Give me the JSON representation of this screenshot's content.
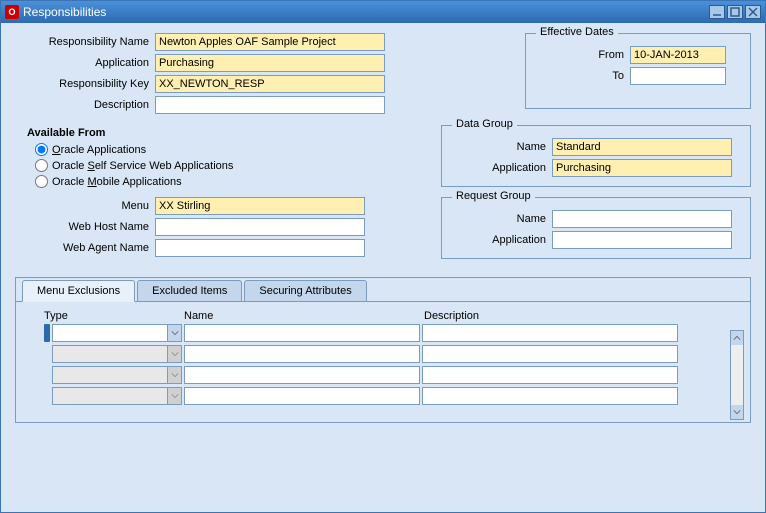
{
  "window": {
    "title": "Responsibilities"
  },
  "fields": {
    "resp_name_label": "Responsibility Name",
    "resp_name": "Newton Apples OAF Sample Project",
    "application_label": "Application",
    "application": "Purchasing",
    "resp_key_label": "Responsibility Key",
    "resp_key": "XX_NEWTON_RESP",
    "description_label": "Description",
    "description": ""
  },
  "effective": {
    "legend": "Effective Dates",
    "from_label": "From",
    "from": "10-JAN-2013",
    "to_label": "To",
    "to": ""
  },
  "available": {
    "title": "Available From",
    "opt1_pre": "",
    "opt1_u": "O",
    "opt1_post": "racle Applications",
    "opt2_pre": "Oracle ",
    "opt2_u": "S",
    "opt2_post": "elf Service Web Applications",
    "opt3_pre": "Oracle ",
    "opt3_u": "M",
    "opt3_post": "obile Applications"
  },
  "data_group": {
    "legend": "Data Group",
    "name_label": "Name",
    "name": "Standard",
    "app_label": "Application",
    "app": "Purchasing"
  },
  "menu_block": {
    "menu_label": "Menu",
    "menu": "XX Stirling",
    "webhost_label": "Web Host Name",
    "webhost": "",
    "webagent_label": "Web Agent Name",
    "webagent": ""
  },
  "request_group": {
    "legend": "Request Group",
    "name_label": "Name",
    "name": "",
    "app_label": "Application",
    "app": ""
  },
  "tabs": {
    "t1": "Menu Exclusions",
    "t2": "Excluded Items",
    "t3": "Securing Attributes"
  },
  "grid": {
    "col_type": "Type",
    "col_name": "Name",
    "col_desc": "Description"
  }
}
